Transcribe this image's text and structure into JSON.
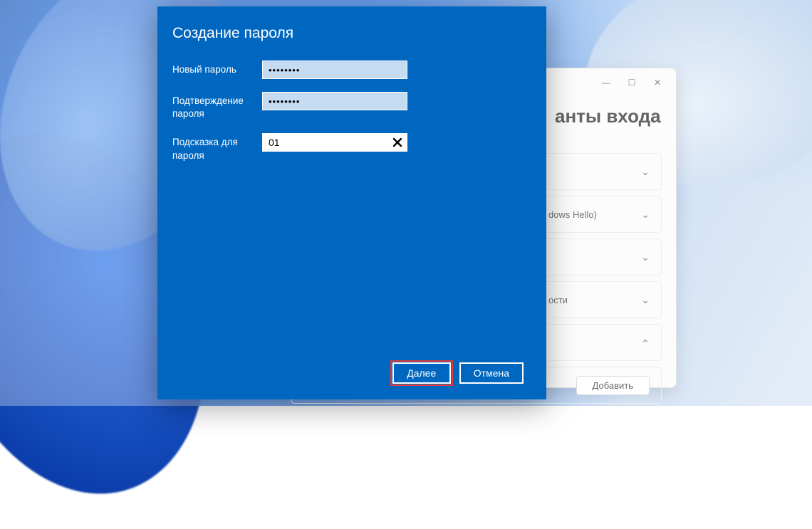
{
  "settings_window": {
    "heading_fragment": "анты входа",
    "controls": {
      "minimize": "—",
      "maximize": "☐",
      "close": "✕"
    },
    "options": [
      {
        "label_fragment": "",
        "expanded": false
      },
      {
        "label_fragment": "dows Hello)",
        "expanded": false
      },
      {
        "label_fragment": "",
        "expanded": false
      },
      {
        "label_fragment": "ости",
        "expanded": false
      },
      {
        "label_fragment": "",
        "expanded": true,
        "add_label": "Добавить"
      }
    ]
  },
  "modal": {
    "title": "Создание пароля",
    "fields": {
      "new_password": {
        "label": "Новый пароль",
        "value": "••••••••"
      },
      "confirm_password": {
        "label": "Подтверждение пароля",
        "value": "••••••••"
      },
      "hint": {
        "label": "Подсказка для пароля",
        "value": "01"
      }
    },
    "buttons": {
      "next": "Далее",
      "cancel": "Отмена"
    }
  }
}
